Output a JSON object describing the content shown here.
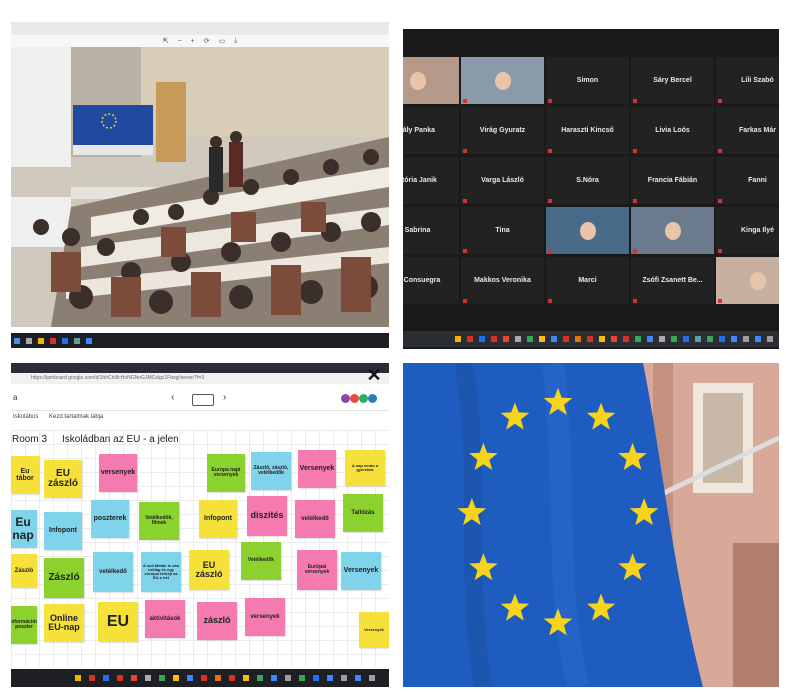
{
  "tiles": {
    "lecture": {
      "viewer_tools": [
        "⇱",
        "−",
        "+",
        "⟳",
        "▭",
        "⤓"
      ]
    },
    "video_call": {
      "participants": [
        {
          "name": "",
          "kind": "video"
        },
        {
          "name": "",
          "kind": "video"
        },
        {
          "name": "Simon",
          "kind": "name"
        },
        {
          "name": "Sáry Bercel",
          "kind": "name"
        },
        {
          "name": "Lili Szabó",
          "kind": "name"
        },
        {
          "name": "rály Panka",
          "kind": "name"
        },
        {
          "name": "Virág Gyuratz",
          "kind": "name"
        },
        {
          "name": "Haraszti Kincső",
          "kind": "name"
        },
        {
          "name": "Livia Loós",
          "kind": "name"
        },
        {
          "name": "Farkas Már",
          "kind": "name"
        },
        {
          "name": "któria Janik",
          "kind": "name"
        },
        {
          "name": "Varga László",
          "kind": "name"
        },
        {
          "name": "S.Nóra",
          "kind": "name"
        },
        {
          "name": "Francia Fábián",
          "kind": "name"
        },
        {
          "name": "Fanni",
          "kind": "name"
        },
        {
          "name": "Sabrina",
          "kind": "name"
        },
        {
          "name": "Tina",
          "kind": "name"
        },
        {
          "name": "",
          "kind": "video"
        },
        {
          "name": "",
          "kind": "video"
        },
        {
          "name": "Kinga Ilyé",
          "kind": "name"
        },
        {
          "name": "or Consuegra",
          "kind": "name"
        },
        {
          "name": "Makkos Veronika",
          "kind": "name"
        },
        {
          "name": "Marci",
          "kind": "name"
        },
        {
          "name": "Zsófi Zsanett Be...",
          "kind": "name"
        },
        {
          "name": "",
          "kind": "video"
        }
      ]
    },
    "board": {
      "address": "https://jamboard.google.com/d/1hhChi8cHoNGNnGJMCsIgc1Fbzg/viewer?f=3",
      "left_link_1": "Iskolábus",
      "left_link_2": "Kezd tartalmak lábja",
      "room_title": "Room 3",
      "board_title": "Iskoládban az EU - a jelen",
      "close_label": "✕",
      "notes": [
        {
          "text": "EU zászló",
          "color": "#f6e03a",
          "size": 10
        },
        {
          "text": "versenyek",
          "color": "#f47ab0",
          "size": 7
        },
        {
          "text": "Europa napi versenyek",
          "color": "#8bd22f",
          "size": 5
        },
        {
          "text": "Zászló, zászló, vetélkedők",
          "color": "#7fd3ea",
          "size": 5
        },
        {
          "text": "Versenyek",
          "color": "#f47ab0",
          "size": 7
        },
        {
          "text": "Infopont",
          "color": "#7fd3ea",
          "size": 7
        },
        {
          "text": "poszterek",
          "color": "#7fd3ea",
          "size": 7
        },
        {
          "text": "Vetélkedők, filmek",
          "color": "#8bd22f",
          "size": 5
        },
        {
          "text": "Infopont",
          "color": "#f6e03a",
          "size": 7
        },
        {
          "text": "díszítés",
          "color": "#f47ab0",
          "size": 9
        },
        {
          "text": "vetélkedő",
          "color": "#f47ab0",
          "size": 6
        },
        {
          "text": "Zászló",
          "color": "#8bd22f",
          "size": 10
        },
        {
          "text": "vetélkedő",
          "color": "#7fd3ea",
          "size": 6
        },
        {
          "text": "A suli táblán is van csillag és egy európai térkép az EU-s hét",
          "color": "#7fd3ea",
          "size": 4
        },
        {
          "text": "EU zászló",
          "color": "#f6e03a",
          "size": 9
        },
        {
          "text": "Vetélkedők",
          "color": "#8bd22f",
          "size": 5
        },
        {
          "text": "Online EU-nap",
          "color": "#f6e03a",
          "size": 9
        },
        {
          "text": "EU",
          "color": "#f6e03a",
          "size": 16
        },
        {
          "text": "aktivitások",
          "color": "#f47ab0",
          "size": 6
        },
        {
          "text": "zászló",
          "color": "#f47ab0",
          "size": 9
        },
        {
          "text": "versenyek",
          "color": "#f47ab0",
          "size": 6
        },
        {
          "text": "Versenyek",
          "color": "#7fd3ea",
          "size": 7
        },
        {
          "text": "Eu nap",
          "color": "#7fd3ea",
          "size": 12
        },
        {
          "text": "Eu tábor",
          "color": "#f6e03a",
          "size": 7
        },
        {
          "text": "Zászló",
          "color": "#f6e03a",
          "size": 6
        },
        {
          "text": "Információs poszter",
          "color": "#8bd22f",
          "size": 5
        },
        {
          "text": "Tallózás",
          "color": "#8bd22f",
          "size": 6
        },
        {
          "text": "A nap során a gyerekek",
          "color": "#f6e03a",
          "size": 4
        },
        {
          "text": "Versenyek",
          "color": "#f6e03a",
          "size": 4
        },
        {
          "text": "Európai versenyek",
          "color": "#f47ab0",
          "size": 5
        }
      ]
    }
  },
  "colors": {
    "eu_blue": "#1e5cbf",
    "eu_star": "#f7d31b"
  }
}
